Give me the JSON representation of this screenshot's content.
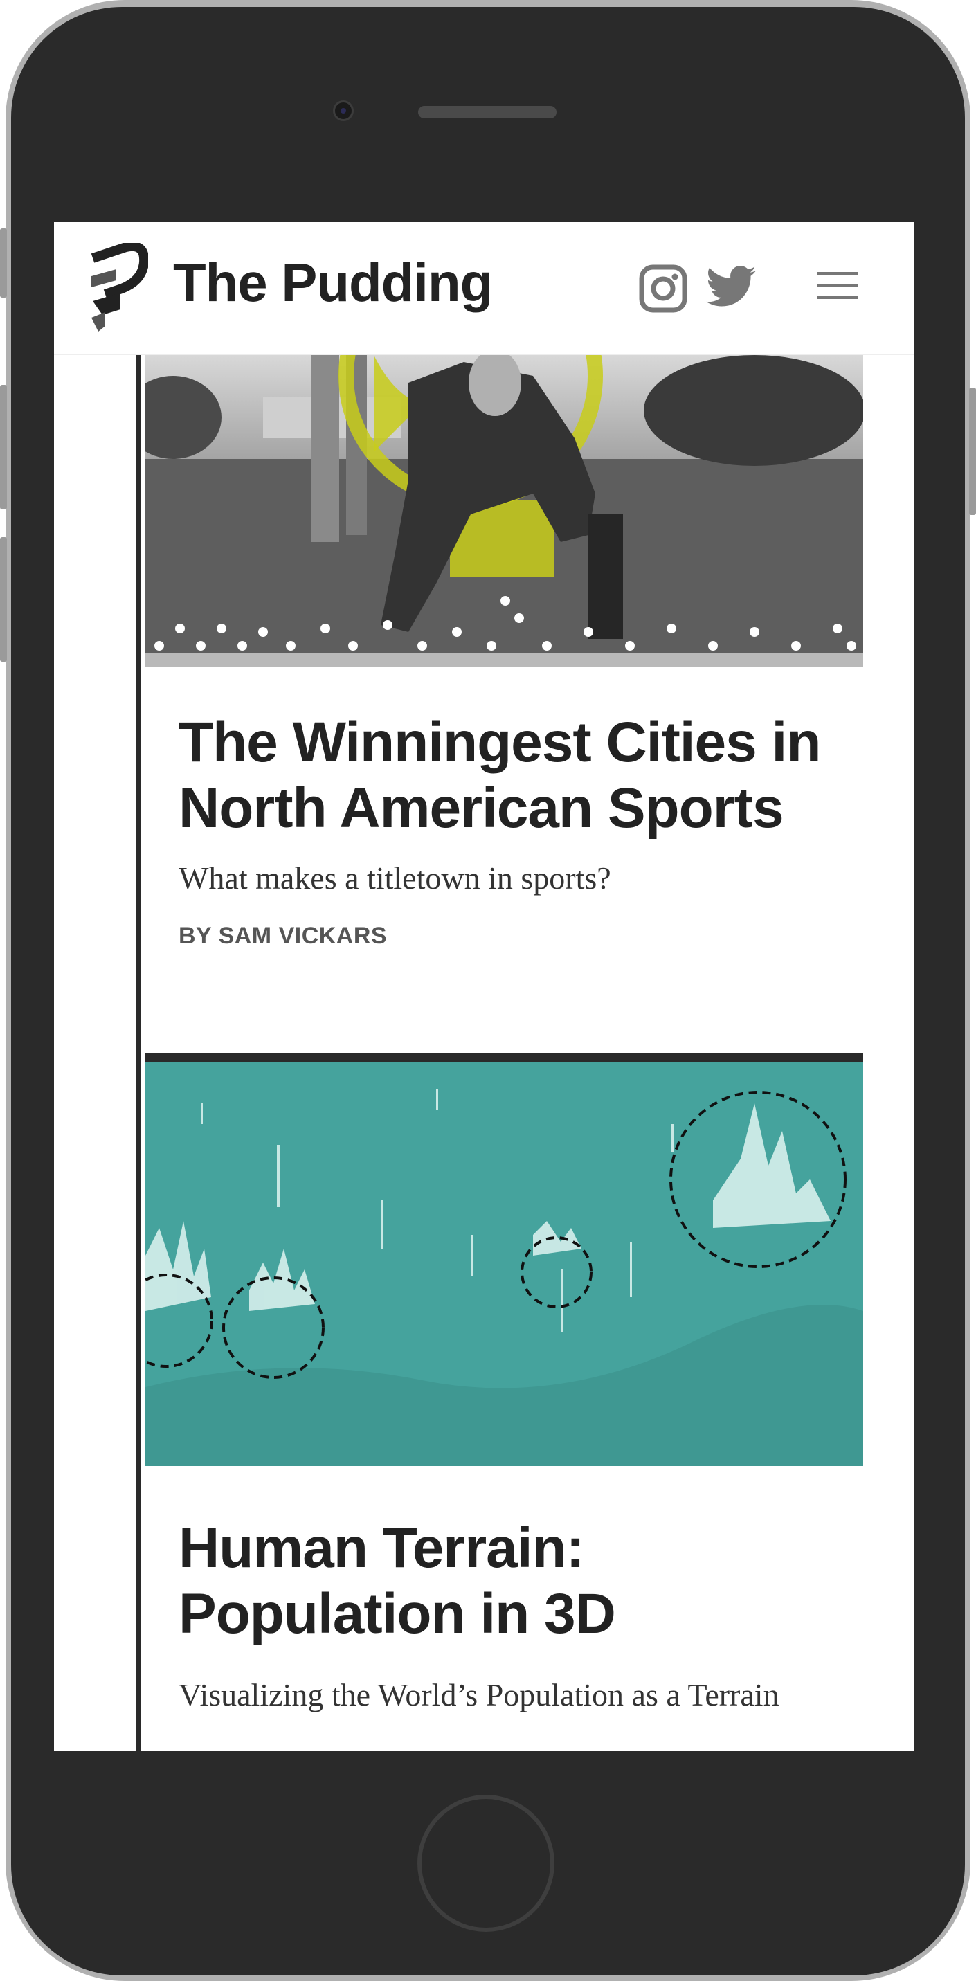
{
  "header": {
    "brand": "The Pudding",
    "icons": [
      "logo-mark",
      "instagram-icon",
      "twitter-icon",
      "menu-icon"
    ]
  },
  "stories": [
    {
      "title": "The Winningest Cities in North American Sports",
      "dek": "What makes a titletown in sports?",
      "byline": "BY SAM VICKARS",
      "image": "football-player-photo"
    },
    {
      "title": "Human Terrain: Population in 3D",
      "dek": "Visualizing the World’s Population as a Terrain",
      "image": "population-terrain-map"
    }
  ],
  "colors": {
    "ink": "#222222",
    "accent_yellow": "#c8cc1a",
    "terrain_teal": "#45a39d",
    "frame": "#2a2a2a"
  }
}
